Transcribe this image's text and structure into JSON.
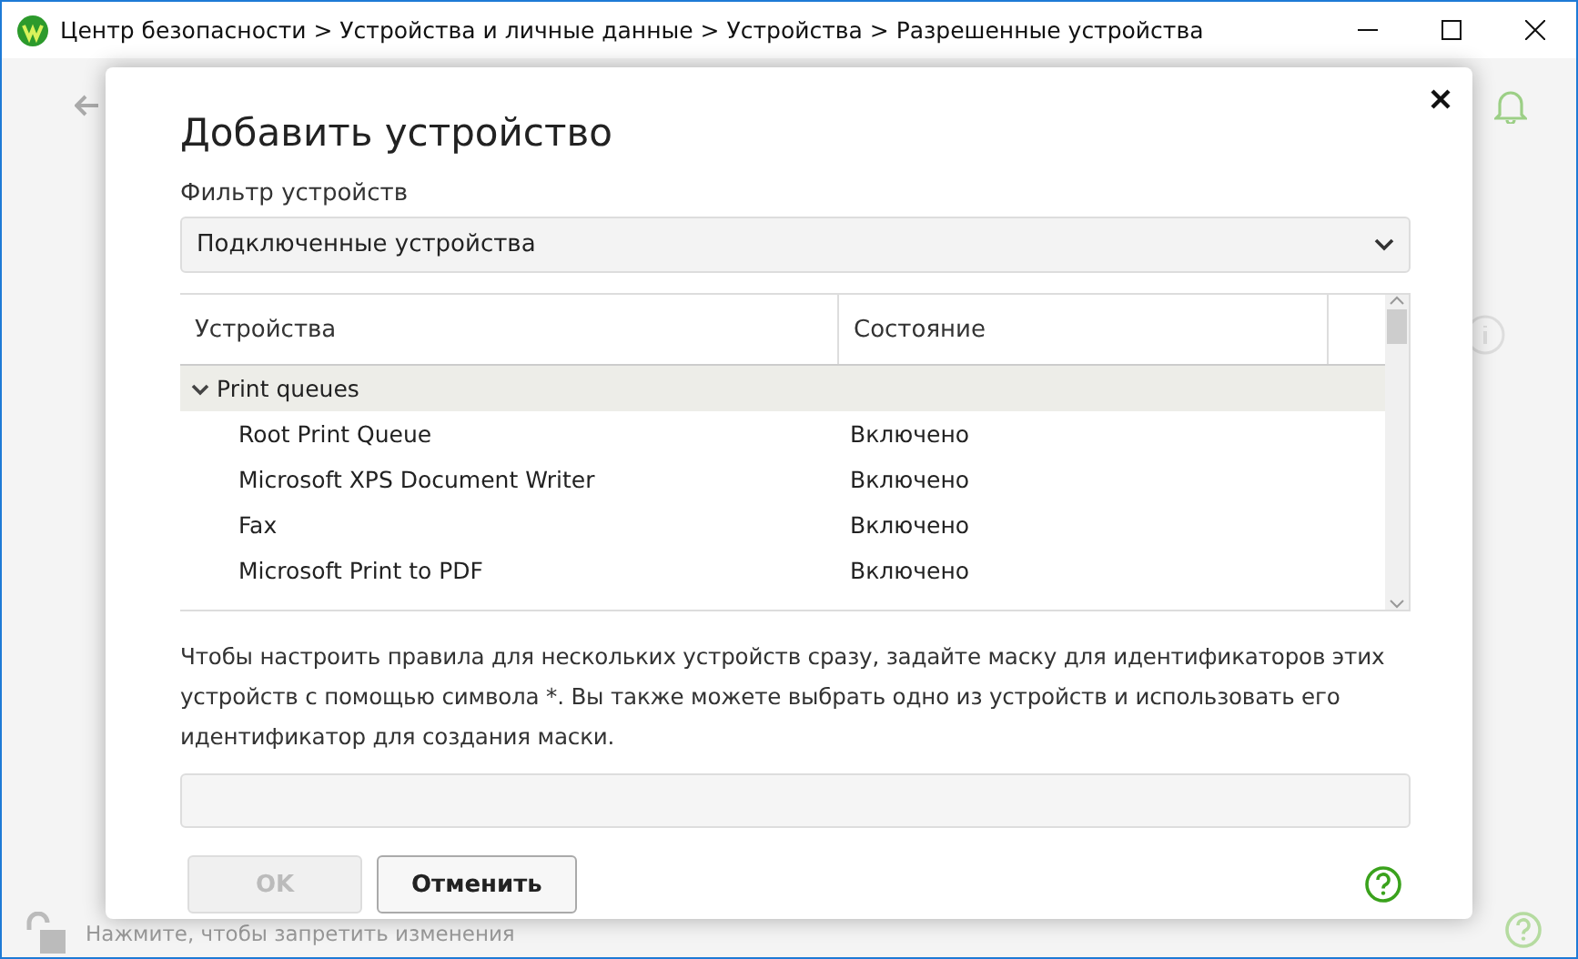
{
  "window": {
    "title": "Центр безопасности > Устройства и личные данные > Устройства > Разрешенные устройства"
  },
  "background": {
    "status_text": "Нажмите, чтобы запретить изменения"
  },
  "dialog": {
    "title": "Добавить устройство",
    "filter_label": "Фильтр устройств",
    "filter_value": "Подключенные устройства",
    "columns": [
      "Устройства",
      "Состояние"
    ],
    "groups": [
      {
        "label": "Print queues",
        "expanded": true,
        "children": [
          {
            "name": "Root Print Queue",
            "state": "Включено"
          },
          {
            "name": "Microsoft XPS Document Writer",
            "state": "Включено"
          },
          {
            "name": "Fax",
            "state": "Включено"
          },
          {
            "name": "Microsoft Print to PDF",
            "state": "Включено"
          }
        ]
      }
    ],
    "hint": "Чтобы настроить правила для нескольких устройств сразу, задайте маску для идентификаторов этих устройств с помощью символа *. Вы также можете выбрать одно из устройств и использовать его идентификатор для создания маски.",
    "buttons": [
      {
        "label": "OK",
        "disabled": true
      },
      {
        "label": "Отменить",
        "disabled": false
      }
    ]
  }
}
